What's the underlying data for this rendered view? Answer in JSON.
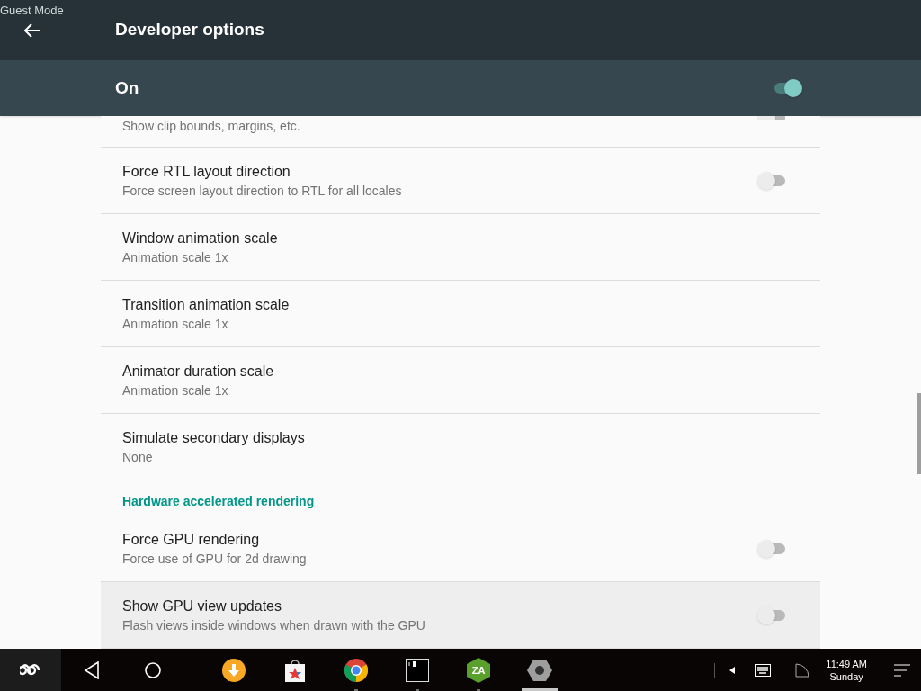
{
  "status_label": "Guest Mode",
  "toolbar": {
    "title": "Developer options"
  },
  "master_switch": {
    "label": "On",
    "on": true
  },
  "items": [
    {
      "kind": "switch",
      "subtitle": "Show clip bounds, margins, etc.",
      "on": false,
      "clipped": true,
      "highlighted": false,
      "no_divider": false
    },
    {
      "kind": "switch",
      "title": "Force RTL layout direction",
      "subtitle": "Force screen layout direction to RTL for all locales",
      "on": false,
      "highlighted": false,
      "no_divider": false
    },
    {
      "kind": "value",
      "title": "Window animation scale",
      "subtitle": "Animation scale 1x",
      "highlighted": false,
      "no_divider": false
    },
    {
      "kind": "value",
      "title": "Transition animation scale",
      "subtitle": "Animation scale 1x",
      "highlighted": false,
      "no_divider": false
    },
    {
      "kind": "value",
      "title": "Animator duration scale",
      "subtitle": "Animation scale 1x",
      "highlighted": false,
      "no_divider": false
    },
    {
      "kind": "value",
      "title": "Simulate secondary displays",
      "subtitle": "None",
      "highlighted": false,
      "no_divider": true
    },
    {
      "kind": "header",
      "title": "Hardware accelerated rendering"
    },
    {
      "kind": "switch",
      "title": "Force GPU rendering",
      "subtitle": "Force use of GPU for 2d drawing",
      "on": false,
      "highlighted": false,
      "no_divider": false
    },
    {
      "kind": "switch",
      "title": "Show GPU view updates",
      "subtitle": "Flash views inside windows when drawn with the GPU",
      "on": false,
      "highlighted": true,
      "no_divider": false
    }
  ],
  "taskbar": {
    "apps": [
      {
        "kind": "download",
        "running": false
      },
      {
        "kind": "store",
        "running": false
      },
      {
        "kind": "browser",
        "running": true,
        "focused": false
      },
      {
        "kind": "terminal",
        "running": true,
        "focused": false
      },
      {
        "kind": "archiver",
        "logo": "ZA",
        "running": true,
        "focused": false
      },
      {
        "kind": "settings",
        "running": true,
        "focused": true
      }
    ],
    "time": "11:49 AM",
    "day": "Sunday"
  }
}
